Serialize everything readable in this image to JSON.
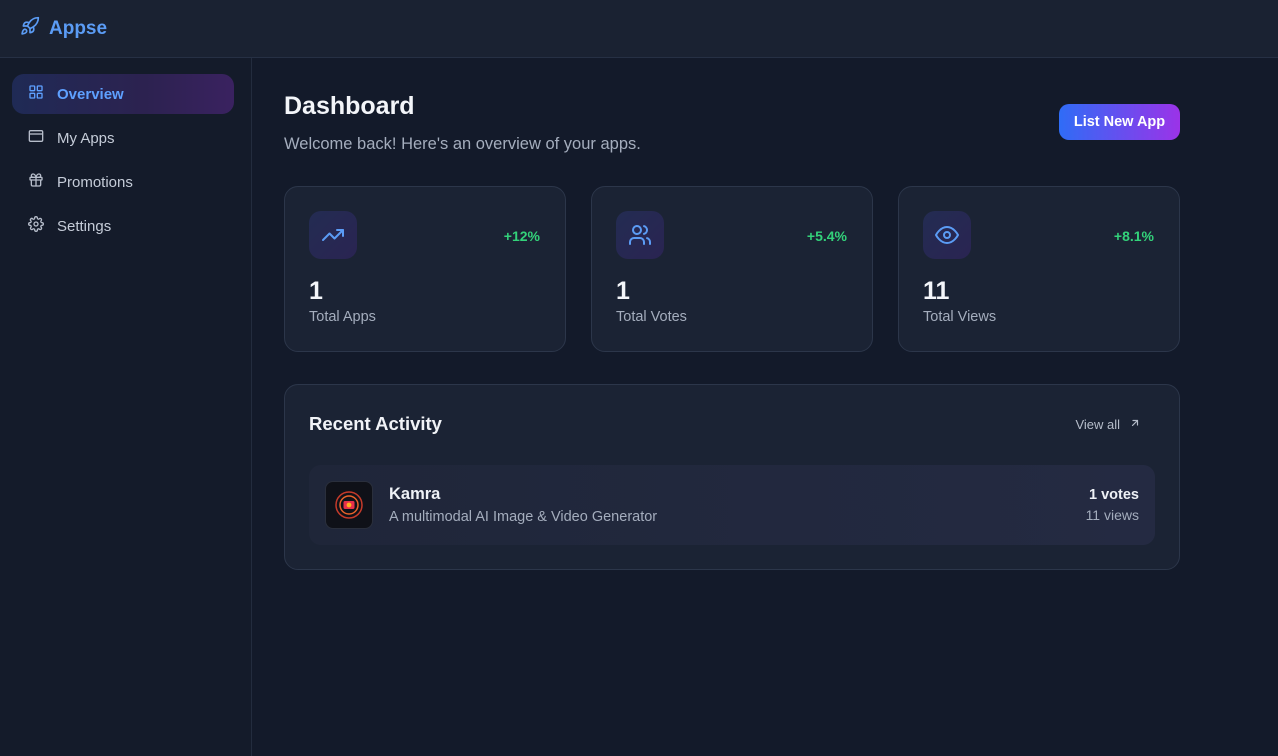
{
  "app": {
    "name": "Appse",
    "logo_icon": "rocket-icon",
    "accent": "#5b9cf5"
  },
  "sidebar": {
    "items": [
      {
        "label": "Overview",
        "icon": "grid-icon",
        "active": true
      },
      {
        "label": "My Apps",
        "icon": "window-icon",
        "active": false
      },
      {
        "label": "Promotions",
        "icon": "gift-icon",
        "active": false
      },
      {
        "label": "Settings",
        "icon": "gear-icon",
        "active": false
      }
    ]
  },
  "header": {
    "title": "Dashboard",
    "subtitle": "Welcome back! Here's an overview of your apps.",
    "cta_label": "List New App"
  },
  "stats": [
    {
      "icon": "trending-up-icon",
      "value": "1",
      "label": "Total Apps",
      "delta": "+12%"
    },
    {
      "icon": "users-icon",
      "value": "1",
      "label": "Total Votes",
      "delta": "+5.4%"
    },
    {
      "icon": "eye-icon",
      "value": "11",
      "label": "Total Views",
      "delta": "+8.1%"
    }
  ],
  "activity": {
    "title": "Recent Activity",
    "view_all_label": "View all",
    "items": [
      {
        "name": "Kamra",
        "description": "A multimodal AI Image & Video Generator",
        "votes": "1 votes",
        "views": "11 views"
      }
    ]
  },
  "colors": {
    "positive": "#33d27a",
    "background": "#131a2a",
    "card": "#1b2334"
  }
}
